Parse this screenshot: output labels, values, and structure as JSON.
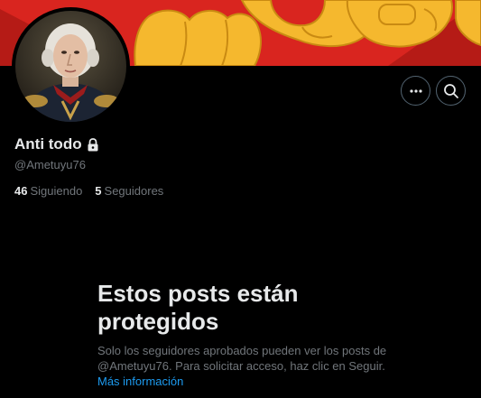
{
  "profile": {
    "display_name": "Anti todo",
    "handle": "@Ametuyu76",
    "lock_icon": "lock-icon",
    "avatar": "portrait of a man in military uniform",
    "banner": "raised yellow fists on red background"
  },
  "actions": {
    "more_icon": "more-horizontal-icon",
    "search_icon": "search-icon"
  },
  "stats": {
    "following_count": "46",
    "following_label": "Siguiendo",
    "followers_count": "5",
    "followers_label": "Seguidores"
  },
  "protected": {
    "title": "Estos posts están protegidos",
    "description": "Solo los seguidores aprobados pueden ver los posts de @Ametuyu76. Para solicitar acceso, haz clic en Seguir.",
    "learn_more": "Más información"
  },
  "colors": {
    "background": "#000000",
    "banner_red": "#d9251f",
    "fist_yellow": "#f5b82e",
    "primary_text": "#e7e9ea",
    "secondary_text": "#71767b",
    "link": "#1d9bf0"
  }
}
